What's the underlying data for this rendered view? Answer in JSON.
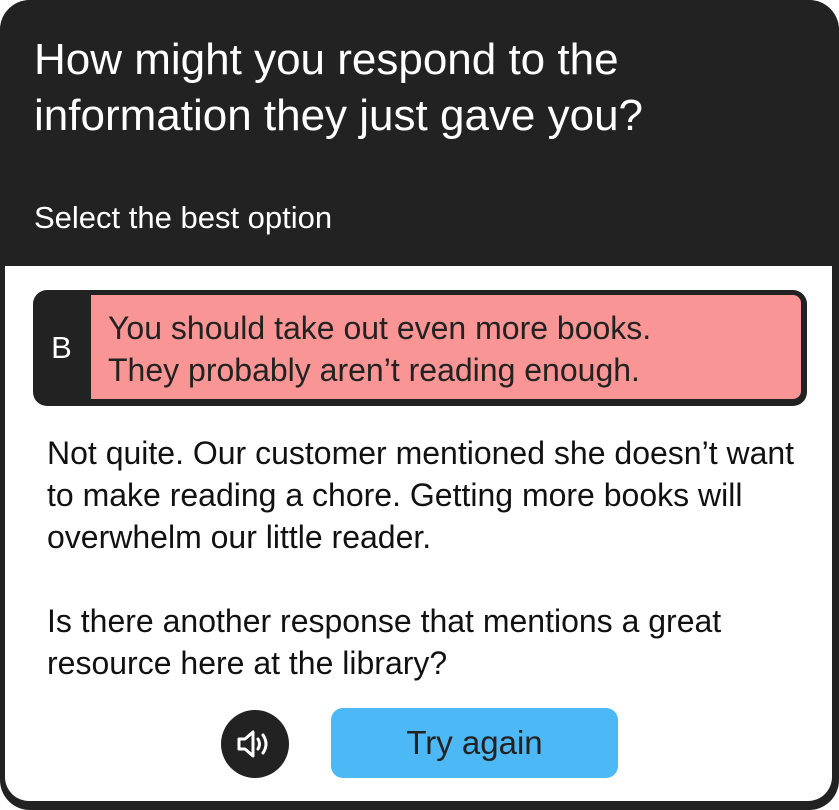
{
  "header": {
    "question": "How might you respond to the information they just gave you?",
    "instruction": "Select the best option"
  },
  "selected_answer": {
    "letter": "B",
    "text_line1": "You should take out even more books.",
    "text_line2": "They probably aren’t reading enough.",
    "state": "incorrect",
    "highlight_color": "#f99594"
  },
  "feedback": {
    "paragraph1": "Not quite. Our customer mentioned she doesn’t want to make reading a chore. Getting more books will overwhelm our little reader.",
    "paragraph2": "Is there another response that mentions a great resource here at the library?"
  },
  "actions": {
    "audio_icon": "speaker-icon",
    "retry_label": "Try again",
    "retry_color": "#4cb8f6"
  }
}
